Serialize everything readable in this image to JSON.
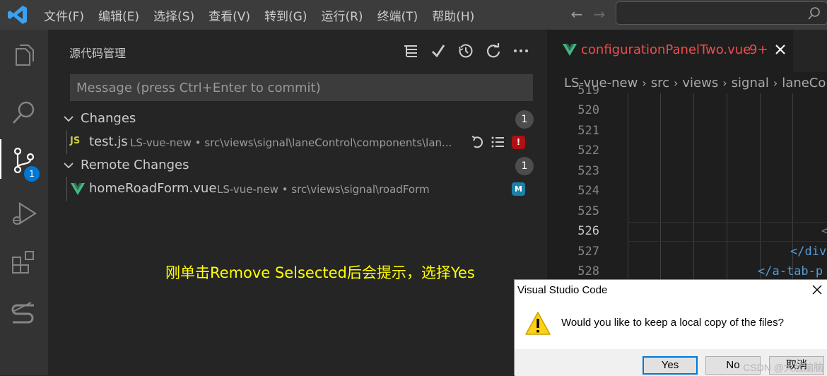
{
  "menu": [
    "文件(F)",
    "编辑(E)",
    "选择(S)",
    "查看(V)",
    "转到(G)",
    "运行(R)",
    "终端(T)",
    "帮助(H)"
  ],
  "activity_bar": {
    "scm_badge": "1",
    "icons": [
      "explorer-icon",
      "search-icon",
      "source-control-icon",
      "run-debug-icon",
      "extensions-icon",
      "s-logo-icon"
    ]
  },
  "scm": {
    "title": "源代码管理",
    "message_placeholder": "Message (press Ctrl+Enter to commit)",
    "groups": [
      {
        "label": "Changes",
        "count": "1",
        "files": [
          {
            "name": "test.js",
            "path": "LS-vue-new • src\\views\\signal\\laneControl\\components\\lan...",
            "status": "!"
          }
        ]
      },
      {
        "label": "Remote Changes",
        "count": "1",
        "files": [
          {
            "name": "homeRoadForm.vue",
            "path": "LS-vue-new • src\\views\\signal\\roadForm",
            "status": "M"
          }
        ]
      }
    ]
  },
  "annotation": "刚单击Remove Selsected后会提示，选择Yes",
  "editor": {
    "tab": {
      "label": "configurationPanelTwo.vue",
      "problems": "9+"
    },
    "breadcrumb": [
      "LS-vue-new",
      "src",
      "views",
      "signal",
      "laneCo"
    ],
    "line_numbers": [
      "519",
      "520",
      "521",
      "522",
      "523",
      "524",
      "525",
      "526",
      "527",
      "528"
    ],
    "current_line": "526",
    "code": {
      "line527": "</div",
      "line528": "</a-tab-p",
      "line526": "<"
    }
  },
  "dialog": {
    "title": "Visual Studio Code",
    "message": "Would you like to keep a local copy of the files?",
    "buttons": [
      "Yes",
      "No",
      "取消"
    ],
    "watermark": "CSDN @大脸脑脑"
  },
  "colors": {
    "titlebar": "#3c3c3c",
    "activitybar": "#333333",
    "sidebar": "#252526",
    "editor": "#1e1e1e",
    "accent": "#0078d4",
    "error_text": "#f14c4c",
    "annotation": "#ffff00"
  }
}
